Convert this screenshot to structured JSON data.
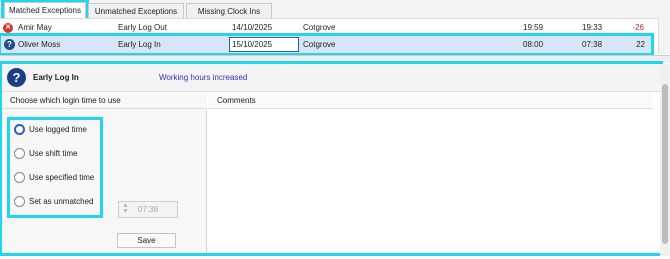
{
  "tabs": [
    {
      "label": "Matched Exceptions",
      "active": true
    },
    {
      "label": "Unmatched Exceptions",
      "active": false
    },
    {
      "label": "Missing Clock Ins",
      "active": false
    }
  ],
  "rows": [
    {
      "name": "Amir May",
      "type": "Early Log Out",
      "date": "14/10/2025",
      "site": "Cotgrove",
      "time1": "19:59",
      "time2": "19:33",
      "diff": "-26",
      "icon": "error-icon"
    },
    {
      "name": "Oliver Moss",
      "type": "Early Log In",
      "date": "15/10/2025",
      "site": "Cotgrove",
      "time1": "08:00",
      "time2": "07:38",
      "diff": "22",
      "icon": "question-icon"
    }
  ],
  "detail": {
    "title": "Early Log In",
    "subtitle": "Working hours increased",
    "left_header": "Choose which login time to use",
    "options": [
      "Use logged time",
      "Use shift time",
      "Use specified time",
      "Set as unmatched"
    ],
    "selected_option": "Use logged time",
    "specified_time": "07:38",
    "save_label": "Save",
    "comments_header": "Comments"
  },
  "colors": {
    "highlight": "#1fd6ee",
    "selected_row": "#d6e6f6",
    "negative": "#dd2222",
    "subtitle": "#3a2fb5"
  }
}
